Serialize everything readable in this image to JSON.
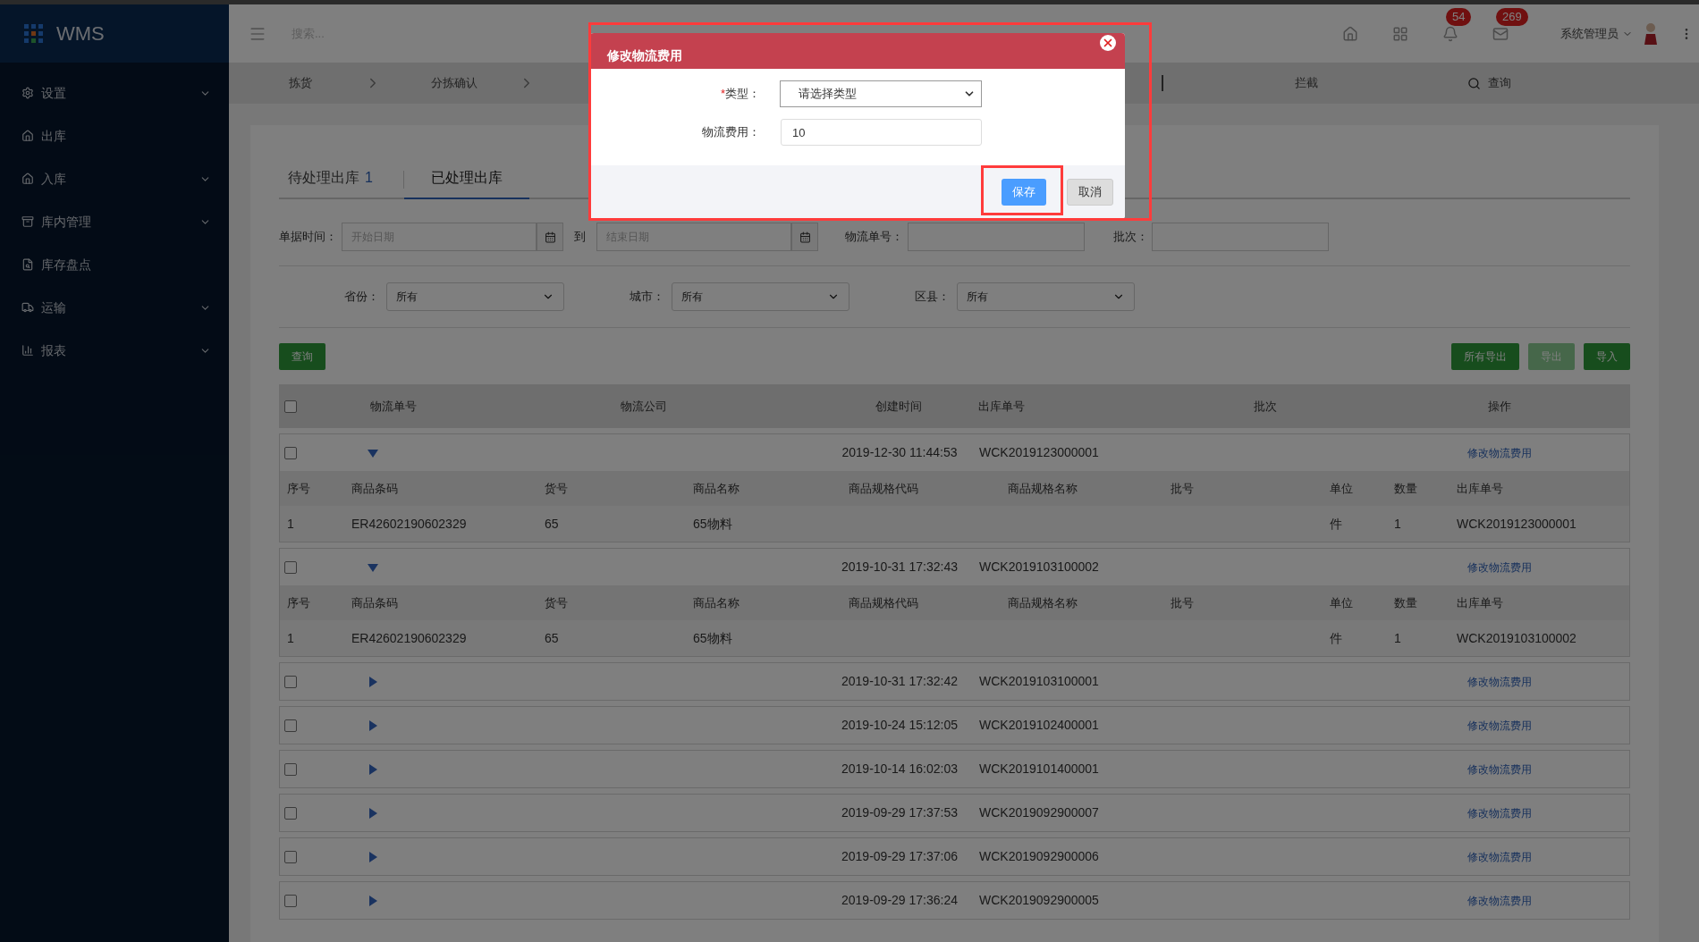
{
  "sidebar": {
    "logo": "WMS",
    "items": [
      {
        "label": "设置",
        "expandable": true
      },
      {
        "label": "出库",
        "expandable": false
      },
      {
        "label": "入库",
        "expandable": true
      },
      {
        "label": "库内管理",
        "expandable": true
      },
      {
        "label": "库存盘点",
        "expandable": false
      },
      {
        "label": "运输",
        "expandable": true
      },
      {
        "label": "报表",
        "expandable": true
      }
    ]
  },
  "topbar": {
    "search": {
      "placeholder": "搜索..."
    },
    "badges": [
      "54",
      "269"
    ],
    "user": "系统管理员"
  },
  "steps": {
    "items": [
      "拣货",
      "分拣确认"
    ],
    "right_items": [
      "拦截",
      "查询"
    ]
  },
  "tabs": [
    {
      "label": "待处理出库",
      "count": "1",
      "selected": false
    },
    {
      "label": "已处理出库",
      "selected": true
    }
  ],
  "filters": {
    "date_label": "单据时间：",
    "start_placeholder": "开始日期",
    "to": "到",
    "end_placeholder": "结束日期",
    "tracking_label": "物流单号：",
    "batch_label": "批次：",
    "selects": [
      {
        "label": "省份：",
        "value": "所有"
      },
      {
        "label": "城市：",
        "value": "所有"
      },
      {
        "label": "区县：",
        "value": "所有"
      }
    ]
  },
  "buttons": {
    "query": "查询",
    "actions": [
      {
        "label": "所有导出",
        "disabled": false
      },
      {
        "label": "导出",
        "disabled": true
      },
      {
        "label": "导入",
        "disabled": false
      }
    ]
  },
  "table": {
    "columns": [
      "物流单号",
      "物流公司",
      "创建时间",
      "出库单号",
      "批次",
      "操作"
    ],
    "all_checked": false,
    "rows": [
      {
        "checked": false,
        "expanded": true,
        "date": "2019-12-30 11:44:53",
        "outbound_no": "WCK2019123000001",
        "action": "修改物流费用",
        "item_columns": [
          "序号",
          "商品条码",
          "货号",
          "商品名称",
          "商品规格代码",
          "商品规格名称",
          "批号",
          "单位",
          "数量",
          "出库单号"
        ],
        "items": [
          {
            "index": "1",
            "barcode": "ER42602190602329",
            "sku": "65",
            "name": "65物料",
            "unit": "件",
            "qty": "1",
            "outbound_no": "WCK2019123000001"
          }
        ]
      },
      {
        "checked": false,
        "expanded": true,
        "date": "2019-10-31 17:32:43",
        "outbound_no": "WCK2019103100002",
        "action": "修改物流费用",
        "item_columns": [
          "序号",
          "商品条码",
          "货号",
          "商品名称",
          "商品规格代码",
          "商品规格名称",
          "批号",
          "单位",
          "数量",
          "出库单号"
        ],
        "items": [
          {
            "index": "1",
            "barcode": "ER42602190602329",
            "sku": "65",
            "name": "65物料",
            "unit": "件",
            "qty": "1",
            "outbound_no": "WCK2019103100002"
          }
        ]
      },
      {
        "checked": false,
        "expanded": false,
        "date": "2019-10-31 17:32:42",
        "outbound_no": "WCK2019103100001",
        "action": "修改物流费用"
      },
      {
        "checked": false,
        "expanded": false,
        "date": "2019-10-24 15:12:05",
        "outbound_no": "WCK2019102400001",
        "action": "修改物流费用"
      },
      {
        "checked": false,
        "expanded": false,
        "date": "2019-10-14 16:02:03",
        "outbound_no": "WCK2019101400001",
        "action": "修改物流费用"
      },
      {
        "checked": false,
        "expanded": false,
        "date": "2019-09-29 17:37:53",
        "outbound_no": "WCK2019092900007",
        "action": "修改物流费用"
      },
      {
        "checked": false,
        "expanded": false,
        "date": "2019-09-29 17:37:06",
        "outbound_no": "WCK2019092900006",
        "action": "修改物流费用"
      },
      {
        "checked": false,
        "expanded": false,
        "date": "2019-09-29 17:36:24",
        "outbound_no": "WCK2019092900005",
        "action": "修改物流费用"
      }
    ]
  },
  "modal": {
    "title": "修改物流费用",
    "fields": [
      {
        "kind": "select",
        "required_mark": "*",
        "label": "类型：",
        "value": "请选择类型"
      },
      {
        "kind": "input",
        "label": "物流费用：",
        "value": "10"
      }
    ],
    "save": "保存",
    "cancel": "取消"
  }
}
